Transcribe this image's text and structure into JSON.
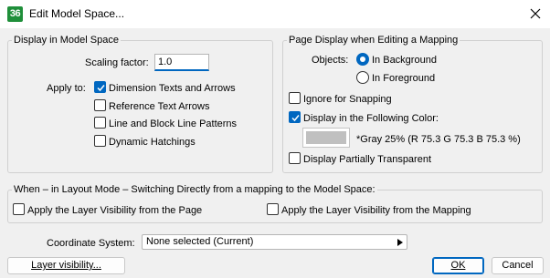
{
  "window": {
    "app_icon_text": "36",
    "title": "Edit Model Space...",
    "close_icon": "close-icon"
  },
  "display_model_space": {
    "legend": "Display in Model Space",
    "scaling_label": "Scaling factor:",
    "scaling_value": "1.0",
    "apply_to_label": "Apply to:",
    "options": [
      {
        "label": "Dimension Texts and Arrows",
        "checked": true
      },
      {
        "label": "Reference Text Arrows",
        "checked": false
      },
      {
        "label": "Line and Block Line Patterns",
        "checked": false
      },
      {
        "label": "Dynamic Hatchings",
        "checked": false
      }
    ]
  },
  "page_display": {
    "legend": "Page Display when Editing a Mapping",
    "objects_label": "Objects:",
    "radio": [
      {
        "label": "In Background",
        "selected": true
      },
      {
        "label": "In Foreground",
        "selected": false
      }
    ],
    "ignore_snapping": {
      "label": "Ignore for Snapping",
      "checked": false
    },
    "display_color": {
      "label": "Display in the Following Color:",
      "checked": true
    },
    "color_swatch": "#c0c0c0",
    "color_text": "*Gray 25% (R 75.3 G 75.3 B 75.3 %)",
    "partially_transparent": {
      "label": "Display Partially Transparent",
      "checked": false
    }
  },
  "layout_mode": {
    "legend": "When – in Layout Mode – Switching Directly from a mapping to the Model Space:",
    "from_page": {
      "label": "Apply the Layer Visibility from the Page",
      "checked": false
    },
    "from_mapping": {
      "label": "Apply the Layer Visibility from the Mapping",
      "checked": false
    }
  },
  "coordinate_system": {
    "label": "Coordinate System:",
    "value": "None selected (Current)",
    "arrow_icon": "triangle-right-icon"
  },
  "buttons": {
    "layer_visibility": "Layer visibility...",
    "ok": "OK",
    "cancel": "Cancel"
  },
  "colors": {
    "accent": "#0067c0",
    "dialog_bg": "#f0f0f0",
    "app_icon_bg": "#1f8f3a"
  }
}
